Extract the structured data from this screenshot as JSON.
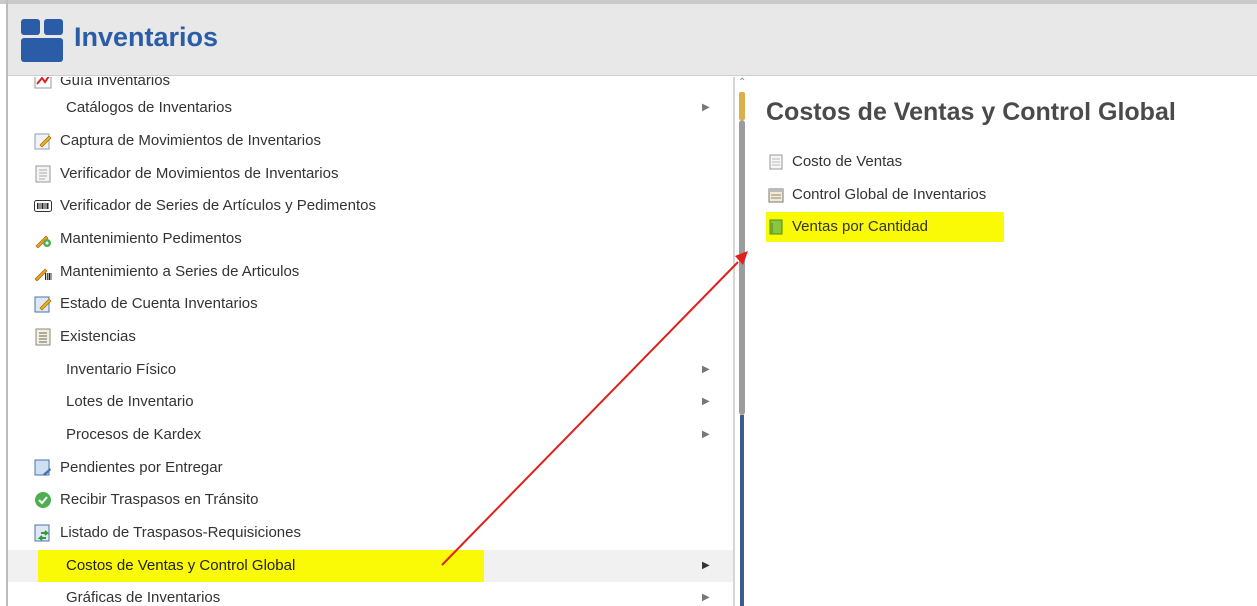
{
  "app": {
    "title": "Inventarios",
    "icon": "inventory-box-icon"
  },
  "menu": {
    "items": [
      {
        "label": "Guía Inventarios",
        "icon": "pdf-icon",
        "submenu": false,
        "cut": true
      },
      {
        "label": "Catálogos de Inventarios",
        "icon": null,
        "submenu": true
      },
      {
        "label": "Captura de Movimientos de Inventarios",
        "icon": "edit-document-icon",
        "submenu": false
      },
      {
        "label": "Verificador de Movimientos de Inventarios",
        "icon": "document-icon",
        "submenu": false
      },
      {
        "label": "Verificador de Series de Artículos y Pedimentos",
        "icon": "barcode-icon",
        "submenu": false
      },
      {
        "label": "Mantenimiento Pedimentos",
        "icon": "wrench-pencil-icon",
        "submenu": false
      },
      {
        "label": "Mantenimiento a Series de Articulos",
        "icon": "pencil-barcode-icon",
        "submenu": false
      },
      {
        "label": "Estado de Cuenta Inventarios",
        "icon": "edit-document-icon",
        "submenu": false
      },
      {
        "label": "Existencias",
        "icon": "document-list-icon",
        "submenu": false
      },
      {
        "label": "Inventario Físico",
        "icon": null,
        "submenu": true
      },
      {
        "label": "Lotes de Inventario",
        "icon": null,
        "submenu": true
      },
      {
        "label": "Procesos de Kardex",
        "icon": null,
        "submenu": true
      },
      {
        "label": "Pendientes por Entregar",
        "icon": "delivery-pending-icon",
        "submenu": false
      },
      {
        "label": "Recibir Traspasos en Tránsito",
        "icon": "check-circle-icon",
        "submenu": false
      },
      {
        "label": "Listado de Traspasos-Requisiciones",
        "icon": "transfer-list-icon",
        "submenu": false
      },
      {
        "label": "Costos de Ventas y Control Global",
        "icon": null,
        "submenu": true,
        "active": true
      },
      {
        "label": "Gráficas de Inventarios",
        "icon": null,
        "submenu": true
      }
    ]
  },
  "submenu_panel": {
    "title": "Costos de Ventas y Control Global",
    "items": [
      {
        "label": "Costo de Ventas",
        "icon": "report-page-icon"
      },
      {
        "label": "Control Global de Inventarios",
        "icon": "report-book-icon"
      },
      {
        "label": "Ventas por Cantidad",
        "icon": "green-report-icon",
        "highlight": true
      }
    ]
  },
  "colors": {
    "title_blue": "#2a5ca8",
    "highlight_yellow": "#fbfa06",
    "annotation_arrow": "#e0201c"
  }
}
